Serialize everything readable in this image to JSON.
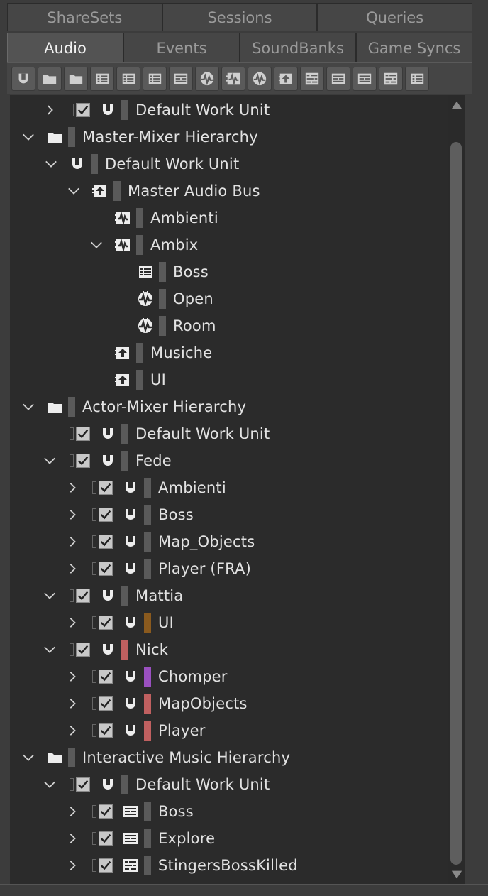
{
  "tabs_top": [
    "ShareSets",
    "Sessions",
    "Queries"
  ],
  "tabs_bottom": [
    "Audio",
    "Events",
    "SoundBanks",
    "Game Syncs"
  ],
  "active_tab": "Audio",
  "toolbar_icons": [
    "work-unit-icon",
    "folder-icon",
    "virtual-folder-icon",
    "actor-mixer-icon",
    "random-container-icon",
    "sequence-container-icon",
    "switch-container-icon",
    "blend-container-icon",
    "sound-sfx-icon",
    "sound-voice-icon",
    "music-segment-icon",
    "music-track-icon",
    "music-switch-icon",
    "music-playlist-icon",
    "music-playlist-container-icon",
    "blend-track-icon"
  ],
  "colors": {
    "default_bar": "#5a5a5a",
    "brown": "#8a5a1e",
    "red": "#c06060",
    "purple": "#9a50c0",
    "panel": "#2b2b2b"
  },
  "tree": [
    {
      "label": "Default Work Unit",
      "depth": 1,
      "toggle": "collapsed",
      "check": true,
      "icon": "work-unit",
      "color": "default"
    },
    {
      "label": "Master-Mixer Hierarchy",
      "depth": 0,
      "toggle": "expanded",
      "check": false,
      "icon": "folder",
      "color": "default"
    },
    {
      "label": "Default Work Unit",
      "depth": 1,
      "toggle": "expanded",
      "check": false,
      "icon": "work-unit",
      "color": "default"
    },
    {
      "label": "Master Audio Bus",
      "depth": 2,
      "toggle": "expanded",
      "check": false,
      "icon": "bus",
      "color": "default"
    },
    {
      "label": "Ambienti",
      "depth": 3,
      "toggle": "none",
      "check": false,
      "icon": "aux-bus",
      "color": "default"
    },
    {
      "label": "Ambix",
      "depth": 3,
      "toggle": "expanded",
      "check": false,
      "icon": "aux-bus",
      "color": "default"
    },
    {
      "label": "Boss",
      "depth": 4,
      "toggle": "none",
      "check": false,
      "icon": "list",
      "color": "default"
    },
    {
      "label": "Open",
      "depth": 4,
      "toggle": "none",
      "check": false,
      "icon": "aux-wave",
      "color": "default"
    },
    {
      "label": "Room",
      "depth": 4,
      "toggle": "none",
      "check": false,
      "icon": "aux-wave",
      "color": "default"
    },
    {
      "label": "Musiche",
      "depth": 3,
      "toggle": "none",
      "check": false,
      "icon": "bus",
      "color": "default"
    },
    {
      "label": "UI",
      "depth": 3,
      "toggle": "none",
      "check": false,
      "icon": "bus",
      "color": "default"
    },
    {
      "label": "Actor-Mixer Hierarchy",
      "depth": 0,
      "toggle": "expanded",
      "check": false,
      "icon": "folder",
      "color": "default"
    },
    {
      "label": "Default Work Unit",
      "depth": 1,
      "toggle": "none",
      "check": true,
      "icon": "work-unit",
      "color": "default"
    },
    {
      "label": "Fede",
      "depth": 1,
      "toggle": "expanded",
      "check": true,
      "icon": "work-unit",
      "color": "default"
    },
    {
      "label": "Ambienti",
      "depth": 2,
      "toggle": "collapsed",
      "check": true,
      "icon": "work-unit",
      "color": "default"
    },
    {
      "label": "Boss",
      "depth": 2,
      "toggle": "collapsed",
      "check": true,
      "icon": "work-unit",
      "color": "default"
    },
    {
      "label": "Map_Objects",
      "depth": 2,
      "toggle": "collapsed",
      "check": true,
      "icon": "work-unit",
      "color": "default"
    },
    {
      "label": "Player (FRA)",
      "depth": 2,
      "toggle": "collapsed",
      "check": true,
      "icon": "work-unit",
      "color": "default"
    },
    {
      "label": "Mattia",
      "depth": 1,
      "toggle": "expanded",
      "check": true,
      "icon": "work-unit",
      "color": "default"
    },
    {
      "label": "UI",
      "depth": 2,
      "toggle": "collapsed",
      "check": true,
      "icon": "work-unit",
      "color": "brown"
    },
    {
      "label": "Nick",
      "depth": 1,
      "toggle": "expanded",
      "check": true,
      "icon": "work-unit",
      "color": "red"
    },
    {
      "label": "Chomper",
      "depth": 2,
      "toggle": "collapsed",
      "check": true,
      "icon": "work-unit",
      "color": "purple"
    },
    {
      "label": "MapObjects",
      "depth": 2,
      "toggle": "collapsed",
      "check": true,
      "icon": "work-unit",
      "color": "red"
    },
    {
      "label": "Player",
      "depth": 2,
      "toggle": "collapsed",
      "check": true,
      "icon": "work-unit",
      "color": "red"
    },
    {
      "label": "Interactive Music Hierarchy",
      "depth": 0,
      "toggle": "expanded",
      "check": false,
      "icon": "folder",
      "color": "default"
    },
    {
      "label": "Default Work Unit",
      "depth": 1,
      "toggle": "expanded",
      "check": true,
      "icon": "work-unit",
      "color": "default"
    },
    {
      "label": "Boss",
      "depth": 2,
      "toggle": "collapsed",
      "check": true,
      "icon": "music-switch",
      "color": "default"
    },
    {
      "label": "Explore",
      "depth": 2,
      "toggle": "collapsed",
      "check": true,
      "icon": "music-switch",
      "color": "default"
    },
    {
      "label": "StingersBossKilled",
      "depth": 2,
      "toggle": "collapsed",
      "check": true,
      "icon": "music-playlist",
      "color": "default"
    }
  ]
}
